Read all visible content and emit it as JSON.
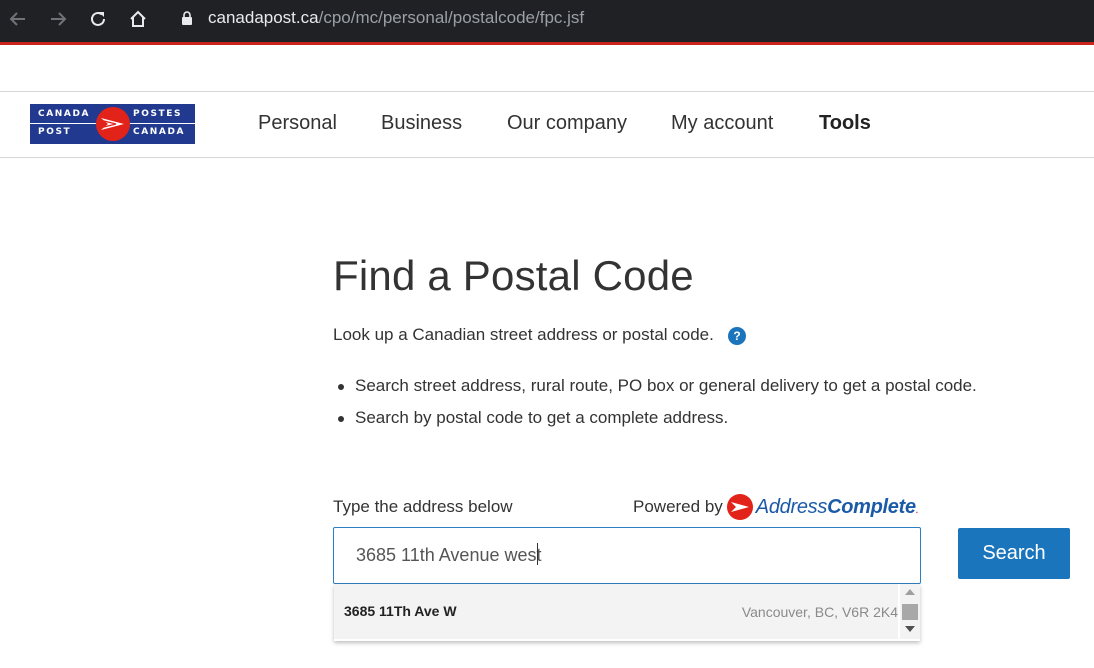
{
  "browser": {
    "url_host": "canadapost.ca",
    "url_path": "/cpo/mc/personal/postalcode/fpc.jsf",
    "icons": [
      "back-icon",
      "forward-icon",
      "reload-icon",
      "home-icon",
      "lock-icon"
    ]
  },
  "header": {
    "logo": {
      "top_left": "CANADA",
      "top_right": "POSTES",
      "bottom_left": "POST",
      "bottom_right": "CANADA"
    },
    "nav": [
      "Personal",
      "Business",
      "Our company",
      "My account",
      "Tools"
    ],
    "active_nav": "Tools"
  },
  "main": {
    "title": "Find a Postal Code",
    "intro": "Look up a Canadian street address or postal code.",
    "help_symbol": "?",
    "bullets": [
      "Search street address, rural route, PO box or general delivery to get a postal code.",
      "Search by postal code to get a complete address."
    ],
    "field_label": "Type the address below",
    "powered_by": "Powered by",
    "address_complete_a": "Address",
    "address_complete_b": "Complete",
    "address_complete_dot": ".",
    "input_value": "3685 11th Avenue west",
    "search_label": "Search",
    "suggestions": [
      {
        "main": "3685 11Th Ave W",
        "sub": "Vancouver, BC, V6R 2K4"
      }
    ]
  },
  "colors": {
    "brand_blue": "#213a8f",
    "brand_red": "#e2231a",
    "button_blue": "#1b75bc",
    "chrome_dark": "#202124"
  }
}
